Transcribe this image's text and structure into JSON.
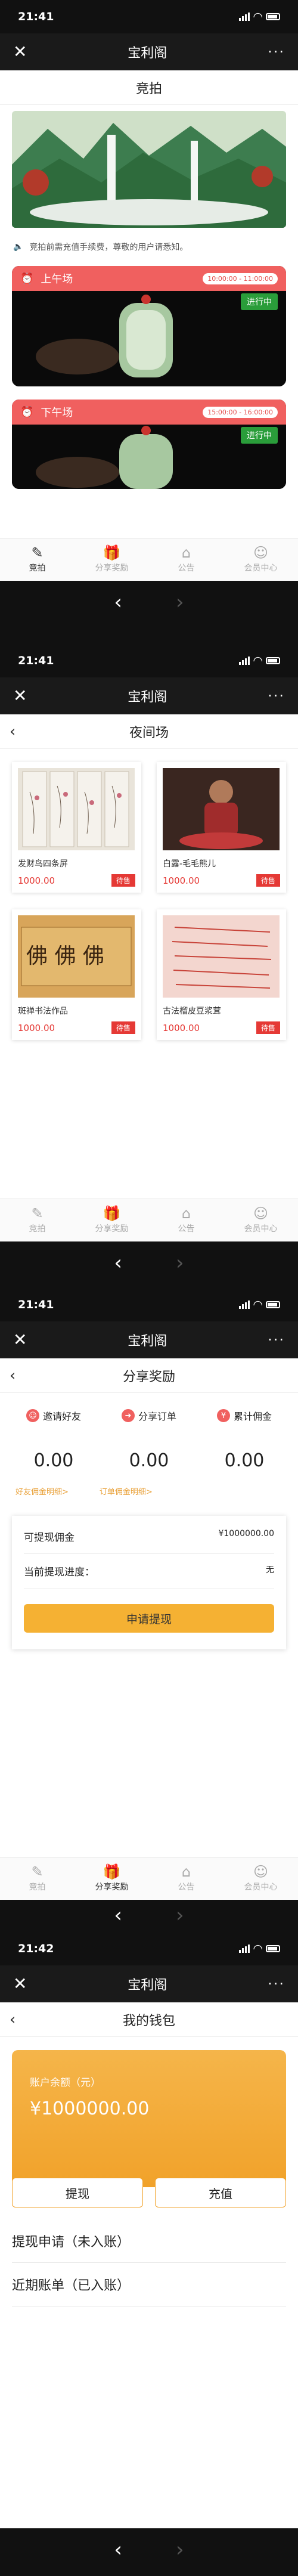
{
  "statusbar": {
    "time_1": "21:41",
    "time_2": "21:41",
    "time_3": "21:41",
    "time_4": "21:42"
  },
  "wechat": {
    "close": "✕",
    "title": "宝利阁",
    "more": "···"
  },
  "auction": {
    "heading": "竞拍",
    "notice": "竞拍前需充值手续费，尊敬的用户请悉知。",
    "sessions": [
      {
        "name": "上午场",
        "time": "10:00:00 - 11:00:00",
        "state": "进行中"
      },
      {
        "name": "下午场",
        "time": "15:00:00 - 16:00:00",
        "state": "进行中"
      }
    ]
  },
  "tabs": [
    {
      "label": "竞拍",
      "icon": "auction-icon"
    },
    {
      "label": "分享奖励",
      "icon": "gift-icon"
    },
    {
      "label": "公告",
      "icon": "bank-icon"
    },
    {
      "label": "会员中心",
      "icon": "user-icon"
    }
  ],
  "night": {
    "title": "夜间场",
    "items": [
      {
        "name": "发财鸟四条屏",
        "price": "1000.00",
        "tag": "待售"
      },
      {
        "name": "白露-毛毛熊儿",
        "price": "1000.00",
        "tag": "待售"
      },
      {
        "name": "斑禅书法作品",
        "price": "1000.00",
        "tag": "待售"
      },
      {
        "name": "古法榴皮豆浆茸",
        "price": "1000.00",
        "tag": "待售"
      }
    ]
  },
  "share": {
    "title": "分享奖励",
    "options": [
      {
        "label": "邀请好友",
        "value": "0.00",
        "link": "好友佣金明细>"
      },
      {
        "label": "分享订单",
        "value": "0.00",
        "link": "订单佣金明细>"
      },
      {
        "label": "累计佣金",
        "value": "0.00"
      }
    ],
    "withdrawable_label": "可提现佣金",
    "withdrawable_value": "¥1000000.00",
    "progress_label": "当前提现进度：",
    "progress_value": "无",
    "apply_label": "申请提现"
  },
  "wallet": {
    "title": "我的钱包",
    "balance_label": "账户余额（元）",
    "balance": "¥1000000.00",
    "withdraw": "提现",
    "recharge": "充值",
    "list": [
      "提现申请（未入账）",
      "近期账单（已入账）"
    ]
  },
  "nav": {
    "back": "‹",
    "forward": "›"
  }
}
